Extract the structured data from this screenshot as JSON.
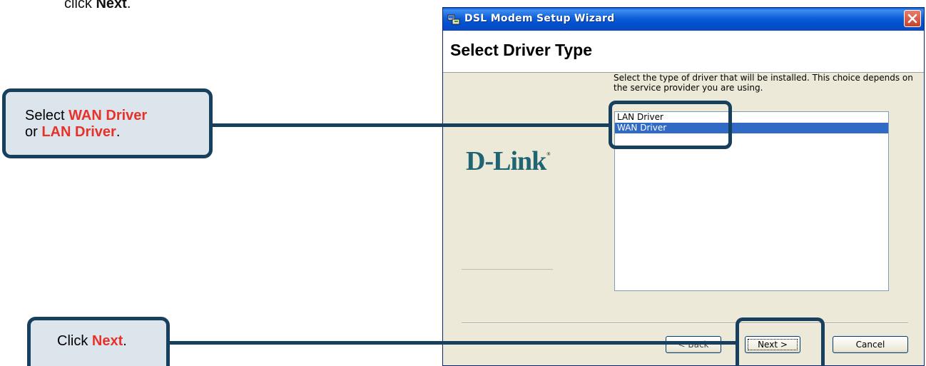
{
  "page": {
    "top_instruction_prefix": "click ",
    "top_instruction_bold": "Next",
    "top_instruction_suffix": "."
  },
  "window": {
    "title": "DSL Modem Setup Wizard",
    "icon": "setup-wizard-icon",
    "close_icon": "close-icon"
  },
  "wizard": {
    "heading": "Select Driver Type",
    "description": "Select the type of driver that will be installed.  This choice depends on the service provider you are using.",
    "logo_text": "D-Link",
    "logo_mark": "®",
    "drivers": [
      {
        "label": "LAN Driver",
        "selected": false
      },
      {
        "label": "WAN Driver",
        "selected": true
      }
    ]
  },
  "buttons": {
    "back": "< Back",
    "next": "Next >",
    "cancel": "Cancel"
  },
  "callouts": {
    "select_prefix": "Select ",
    "select_wan": "WAN Driver",
    "select_mid": "or ",
    "select_lan": "LAN Driver",
    "select_suffix": ".",
    "next_prefix": "Click ",
    "next_bold": "Next",
    "next_suffix": "."
  },
  "colors": {
    "accent_red": "#e8312a",
    "callout_border": "#17405e",
    "callout_fill": "#dce5ec",
    "selection_blue": "#316ac5"
  }
}
